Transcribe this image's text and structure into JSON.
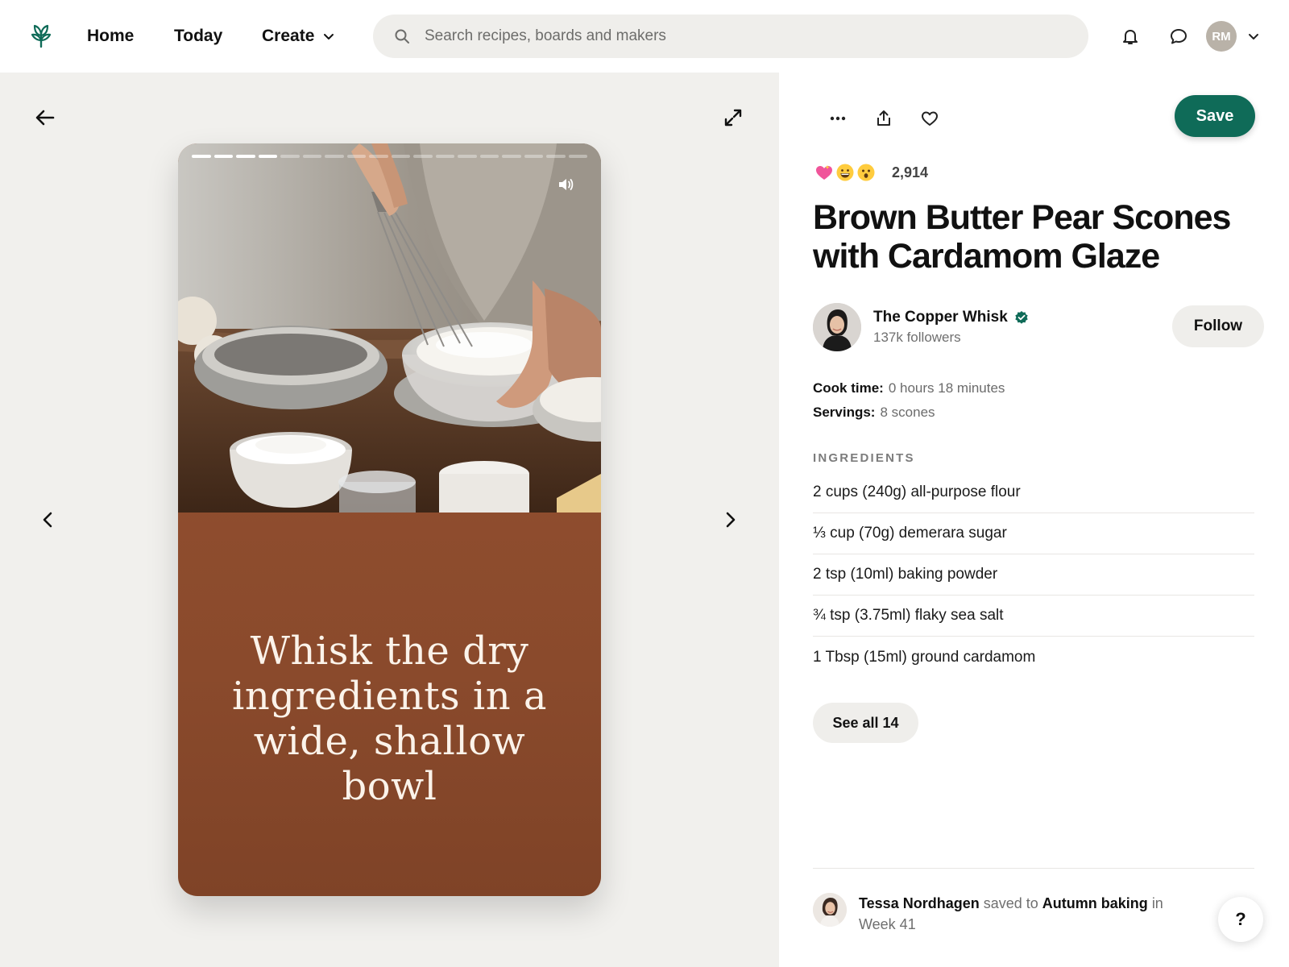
{
  "nav": {
    "logo_icon": "sprout-logo-icon",
    "home_label": "Home",
    "today_label": "Today",
    "create_label": "Create",
    "search_placeholder": "Search recipes, boards and makers",
    "user_initials": "RM"
  },
  "story": {
    "total_segments": 18,
    "viewed_segments": 4,
    "caption": "Whisk the dry ingredients in a wide, shallow bowl",
    "photo_description_icon": "mixing-bowl-photo"
  },
  "reactions": {
    "emojis": [
      "heart-emoji",
      "grin-emoji",
      "surprised-emoji"
    ],
    "count": "2,914"
  },
  "recipe": {
    "title": "Brown Butter Pear Scones with Cardamom Glaze",
    "save_label": "Save"
  },
  "creator": {
    "name": "The Copper Whisk",
    "followers": "137k followers",
    "follow_label": "Follow",
    "verified": true
  },
  "meta": {
    "cook_label": "Cook time:",
    "cook_value": "0 hours 18 minutes",
    "servings_label": "Servings:",
    "servings_value": "8 scones"
  },
  "ingredients": {
    "heading": "INGREDIENTS",
    "items": [
      "2 cups (240g) all-purpose flour",
      "⅓ cup (70g) demerara sugar",
      "2 tsp (10ml) baking powder",
      "¾ tsp (3.75ml) flaky sea salt",
      "1 Tbsp (15ml) ground cardamom"
    ],
    "see_all_label": "See all 14"
  },
  "activity": {
    "user": "Tessa Nordhagen",
    "saved_to": "saved to",
    "board": "Autumn baking",
    "in": "in",
    "section": "Week 41"
  },
  "help_label": "?",
  "colors": {
    "accent": "#0f6b58",
    "story_bg": "#8a4a2c",
    "pane_bg": "#f1f0ed",
    "chip_bg": "#efeeeb"
  }
}
